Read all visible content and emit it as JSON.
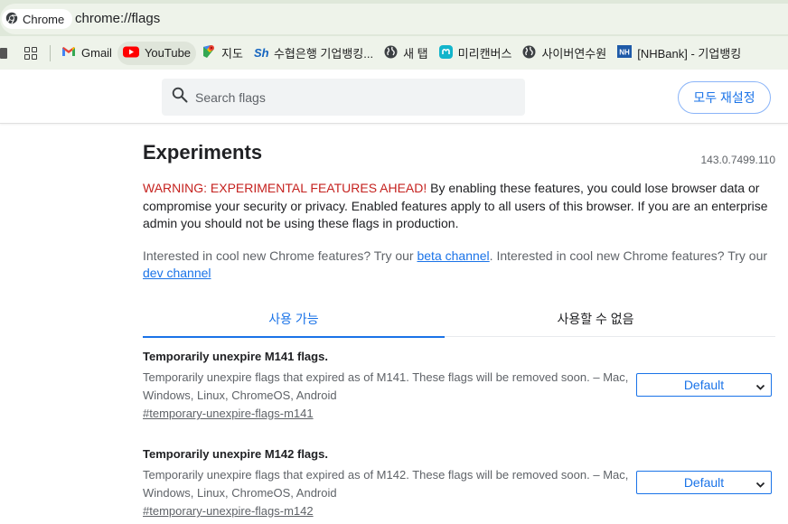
{
  "omnibox": {
    "site_chip_label": "Chrome",
    "url": "chrome://flags"
  },
  "bookmarks": {
    "items": [
      {
        "label": "Gmail",
        "icon": "gmail-icon"
      },
      {
        "label": "YouTube",
        "icon": "youtube-icon"
      },
      {
        "label": "지도",
        "icon": "maps-icon"
      },
      {
        "label": "수협은행 기업뱅킹...",
        "icon": "suhyup-bank-icon"
      },
      {
        "label": "새 탭",
        "icon": "globe-icon"
      },
      {
        "label": "미리캔버스",
        "icon": "miricanvas-icon"
      },
      {
        "label": "사이버연수원",
        "icon": "globe-icon"
      },
      {
        "label": "[NHBank] - 기업뱅킹",
        "icon": "nh-bank-icon"
      }
    ]
  },
  "header": {
    "search_placeholder": "Search flags",
    "reset_label": "모두 재설정"
  },
  "main": {
    "title": "Experiments",
    "version": "143.0.7499.110",
    "warning_lead": "WARNING: EXPERIMENTAL FEATURES AHEAD!",
    "warning_body": " By enabling these features, you could lose browser data or compromise your security or privacy. Enabled features apply to all users of this browser. If you are an enterprise admin you should not be using these flags in production.",
    "interest_1": "Interested in cool new Chrome features? Try our ",
    "beta_link": "beta channel",
    "interest_2": ". Interested in cool new Chrome features? Try our ",
    "dev_link": "dev channel"
  },
  "tabs": [
    {
      "label": "사용 가능",
      "selected": true
    },
    {
      "label": "사용할 수 없음",
      "selected": false
    }
  ],
  "experiments": [
    {
      "title": "Temporarily unexpire M141 flags.",
      "description": "Temporarily unexpire flags that expired as of M141. These flags will be removed soon. – Mac, Windows, Linux, ChromeOS, Android",
      "link": "#temporary-unexpire-flags-m141",
      "value": "Default"
    },
    {
      "title": "Temporarily unexpire M142 flags.",
      "description": "Temporarily unexpire flags that expired as of M142. These flags will be removed soon. – Mac, Windows, Linux, ChromeOS, Android",
      "link": "#temporary-unexpire-flags-m142",
      "value": "Default"
    }
  ],
  "colors": {
    "accent": "#1a73e8",
    "warning": "#c5221f",
    "toolbar": "#eef3ea"
  }
}
